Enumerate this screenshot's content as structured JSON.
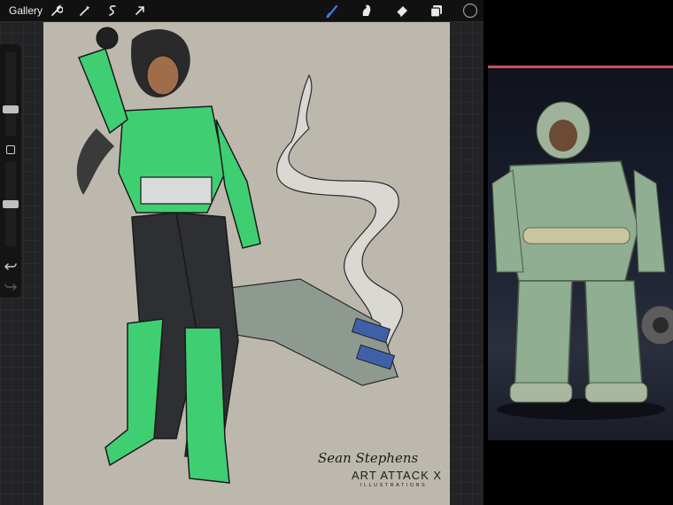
{
  "toolbar": {
    "gallery_label": "Gallery",
    "left_tools": [
      "wrench-icon",
      "magic-wand-icon",
      "selection-icon",
      "transform-arrow-icon"
    ],
    "right_tools": [
      "brush-icon",
      "smudge-icon",
      "eraser-icon",
      "layers-icon",
      "color-swatch-icon"
    ],
    "active_tool": "brush-icon",
    "active_color": "#3d7bd9",
    "current_color": "#111111"
  },
  "sidebar": {
    "brush_size_level": 0.3,
    "opacity_level": 0.5,
    "icons": [
      "undo-icon",
      "redo-icon"
    ]
  },
  "canvas": {
    "background": "#bdb8ae"
  },
  "watermark": {
    "signature": "Sean Stephens",
    "title": "ART ATTACK X",
    "subtitle": "ILLUSTRATIONS"
  },
  "reference": {
    "accent_bar": "#c8505e"
  }
}
